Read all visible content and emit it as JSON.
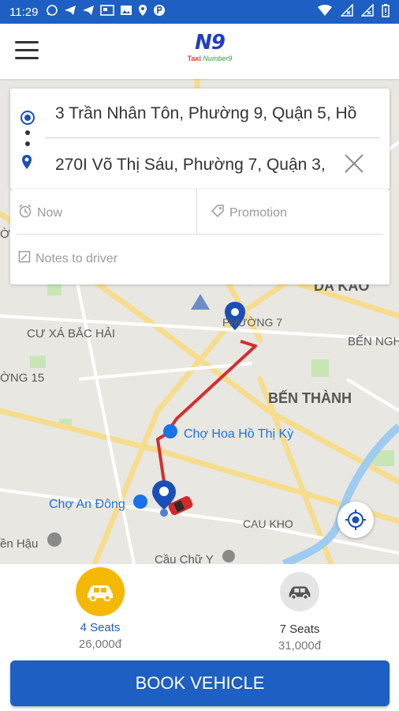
{
  "status_bar": {
    "time": "11:29",
    "icons_left": [
      "whatsapp-icon",
      "send-icon",
      "send-icon",
      "news-icon",
      "image-icon",
      "location-icon",
      "p-icon"
    ],
    "icons_right": [
      "wifi-icon",
      "no-signal-icon",
      "no-signal-icon",
      "battery-icon"
    ],
    "background": "#1d5fc2"
  },
  "app_bar": {
    "logo_main": "N9",
    "logo_sub_prefix": "Taxi",
    "logo_sub_brand": "Number9"
  },
  "route": {
    "pickup": "3 Trần Nhân Tôn, Phường 9, Quận 5, Hồ",
    "destination": "270I Võ Thị Sáu, Phường 7, Quận 3,"
  },
  "options": {
    "time_label": "Now",
    "promotion_label": "Promotion",
    "notes_placeholder": "Notes to driver"
  },
  "map": {
    "labels": {
      "da_kao": "DA KAO",
      "phuong_7": "PHƯỜNG 7",
      "cu_xa": "CƯ XÁ BẮC HẢI",
      "ben_nghe": "BẾN NGHÉ",
      "phuong_15": "ỜNG 15",
      "ben_thanh": "BẾN THÀNH",
      "cho_hoa": "Chợ Hoa Hồ Thị Kỳ",
      "cho_an_dong": "Chợ An Đông",
      "cau_kho": "CAU KHO",
      "hau": "ền Hậu",
      "cau_chu_y": "Cầu Chữ Y",
      "phuong_edge": "ỜI"
    },
    "route_color": "#d32f2f",
    "pin_color": "#1a4fb8"
  },
  "vehicles": [
    {
      "name": "4 Seats",
      "price": "26,000đ",
      "selected": true,
      "icon": "car-icon",
      "accent": "#f5b800"
    },
    {
      "name": "7 Seats",
      "price": "31,000đ",
      "selected": false,
      "icon": "car-icon",
      "accent": "#e5e5e5"
    }
  ],
  "book_button": "BOOK VEHICLE"
}
